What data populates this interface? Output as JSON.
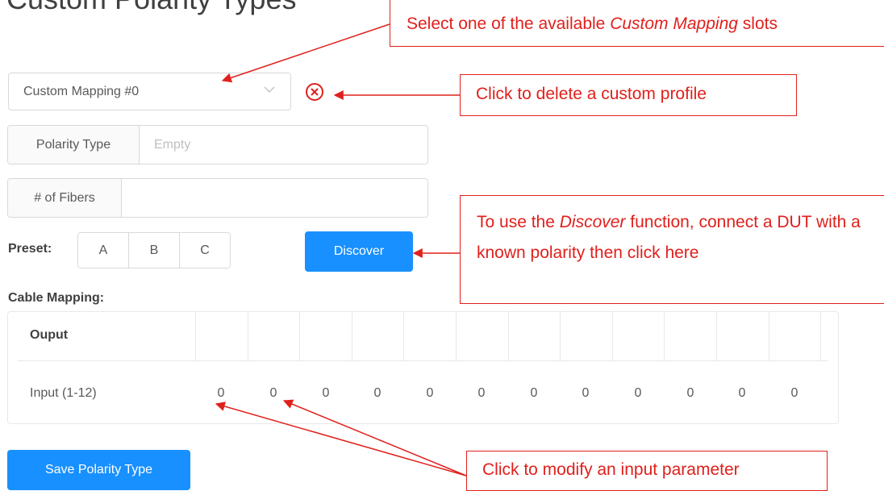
{
  "page": {
    "title": "Custom Polarity Types"
  },
  "mapping_select": {
    "value": "Custom Mapping #0"
  },
  "polarity_type": {
    "label": "Polarity Type",
    "placeholder": "Empty"
  },
  "fibers": {
    "label": "# of Fibers",
    "value": ""
  },
  "preset": {
    "label": "Preset:",
    "options": [
      "A",
      "B",
      "C"
    ]
  },
  "discover_button": {
    "label": "Discover"
  },
  "cable_mapping": {
    "label": "Cable Mapping:",
    "output_header": "Ouput",
    "input_label": "Input (1-12)",
    "inputs": [
      "0",
      "0",
      "0",
      "0",
      "0",
      "0",
      "0",
      "0",
      "0",
      "0",
      "0",
      "0"
    ]
  },
  "save_button": {
    "label": "Save Polarity Type"
  },
  "callouts": {
    "select_slot": {
      "pre": "Select one of the available ",
      "em": "Custom Mapping",
      "post": " slots"
    },
    "delete_profile": {
      "text": "Click to delete a custom profile"
    },
    "discover": {
      "pre": "To use the ",
      "em": "Discover",
      "post": " function, connect a DUT with a known polarity then click here"
    },
    "modify_input": {
      "text": "Click to modify an input parameter"
    }
  },
  "colors": {
    "accent": "#1890ff",
    "annotation": "#e0201c",
    "delete_icon": "#e0201c"
  }
}
